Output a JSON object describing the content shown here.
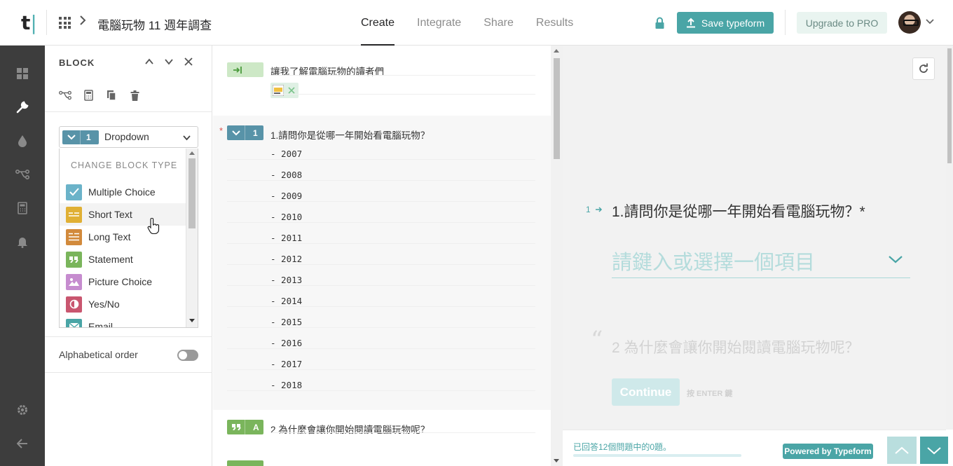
{
  "header": {
    "logo_letter": "t",
    "logo_bar": "|",
    "form_title": "電腦玩物 11 週年調查",
    "tabs": [
      {
        "label": "Create",
        "active": true
      },
      {
        "label": "Integrate",
        "active": false
      },
      {
        "label": "Share",
        "active": false
      },
      {
        "label": "Results",
        "active": false
      }
    ],
    "save_label": "Save typeform",
    "upgrade_label": "Upgrade to PRO"
  },
  "rail": {
    "icons": [
      "dashboard-icon",
      "wrench-icon",
      "drop-icon",
      "logic-icon",
      "calculator-icon",
      "bell-icon",
      "settings-icon",
      "back-arrow-icon"
    ]
  },
  "block_panel": {
    "title": "BLOCK",
    "selected_type": {
      "number": "1",
      "label": "Dropdown"
    },
    "menu_title": "CHANGE BLOCK TYPE",
    "menu_items": [
      {
        "label": "Multiple Choice",
        "color": "#6bb3c9",
        "icon": "check-icon"
      },
      {
        "label": "Short Text",
        "color": "#e0b034",
        "icon": "short-text-icon"
      },
      {
        "label": "Long Text",
        "color": "#d28a3c",
        "icon": "long-text-icon"
      },
      {
        "label": "Statement",
        "color": "#7ab55c",
        "icon": "quote-icon"
      },
      {
        "label": "Picture Choice",
        "color": "#c68ccf",
        "icon": "picture-icon"
      },
      {
        "label": "Yes/No",
        "color": "#c9566f",
        "icon": "yes-no-icon"
      },
      {
        "label": "Email",
        "color": "#4aa5a6",
        "icon": "email-icon"
      }
    ],
    "alphabetical_label": "Alphabetical order"
  },
  "editor": {
    "welcome_text": "讓我了解電腦玩物的讀者們",
    "question": {
      "number": "1",
      "text": "1.請問你是從哪一年開始看電腦玩物？",
      "required_mark": "*"
    },
    "choices": [
      "- 2007",
      "- 2008",
      "- 2009",
      "- 2010",
      "- 2011",
      "- 2012",
      "- 2013",
      "- 2014",
      "- 2015",
      "- 2016",
      "- 2017",
      "- 2018"
    ],
    "statement": {
      "letter": "A",
      "text": "2 為什麼會讓你開始閱讀電腦玩物呢？"
    }
  },
  "preview": {
    "q_number": "1",
    "q_text": "1.請問你是從哪一年開始看電腦玩物？*",
    "placeholder": "請鍵入或選擇一個項目",
    "quote_mark": "“",
    "q2_text": "2 為什麼會讓你開始閱讀電腦玩物呢？",
    "continue_label": "Continue",
    "enter_hint": "按 ENTER 鍵",
    "progress_text": "已回答12個問題中的0題。",
    "progress": 0,
    "powered_by": "Powered by Typeform"
  },
  "colors": {
    "accent": "#4aa5a6",
    "dropdown_badge": "#5893a8",
    "statement_badge": "#7ab55c",
    "rail_bg": "#3d3d3d"
  }
}
